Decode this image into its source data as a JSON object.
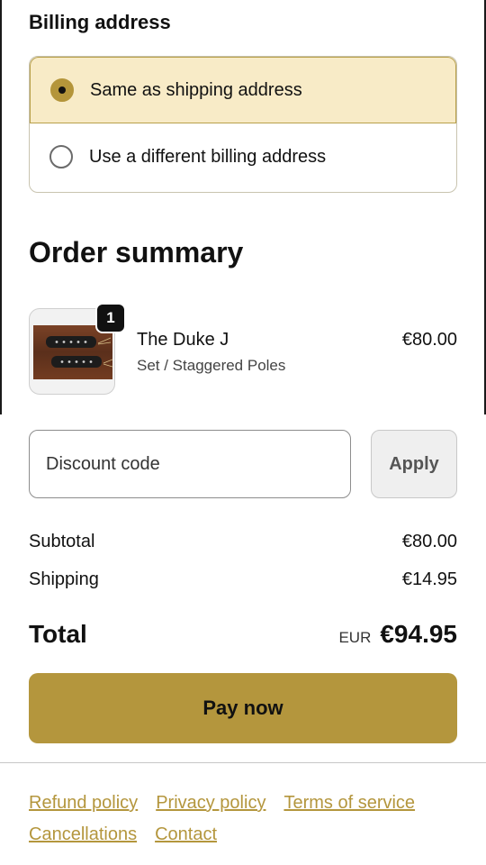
{
  "billing": {
    "title": "Billing address",
    "options": [
      {
        "label": "Same as shipping address",
        "selected": true
      },
      {
        "label": "Use a different billing address",
        "selected": false
      }
    ]
  },
  "summary": {
    "title": "Order summary",
    "product": {
      "name": "The Duke J",
      "variant": "Set / Staggered Poles",
      "price": "€80.00",
      "quantity": "1"
    }
  },
  "discount": {
    "placeholder": "Discount code",
    "apply_label": "Apply"
  },
  "totals": {
    "subtotal_label": "Subtotal",
    "subtotal_value": "€80.00",
    "shipping_label": "Shipping",
    "shipping_value": "€14.95",
    "total_label": "Total",
    "currency": "EUR",
    "total_value": "€94.95"
  },
  "pay": {
    "label": "Pay now"
  },
  "footer": {
    "links": [
      "Refund policy",
      "Privacy policy",
      "Terms of service",
      "Cancellations",
      "Contact"
    ]
  },
  "colors": {
    "accent": "#b4963d",
    "selected_bg": "#f8ebc7"
  }
}
